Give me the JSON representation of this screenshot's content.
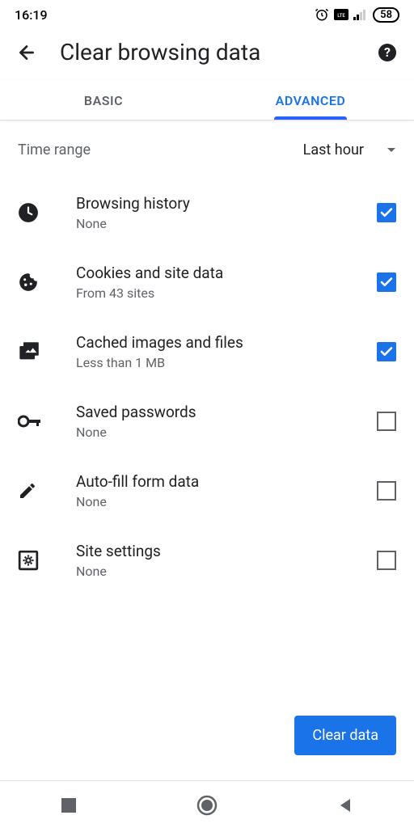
{
  "status": {
    "time": "16:19",
    "battery": "58"
  },
  "header": {
    "title": "Clear browsing data"
  },
  "tabs": {
    "basic": "BASIC",
    "advanced": "ADVANCED"
  },
  "timeRange": {
    "label": "Time range",
    "value": "Last hour"
  },
  "items": [
    {
      "title": "Browsing history",
      "subtitle": "None",
      "checked": true,
      "icon": "clock"
    },
    {
      "title": "Cookies and site data",
      "subtitle": "From 43 sites",
      "checked": true,
      "icon": "cookie"
    },
    {
      "title": "Cached images and files",
      "subtitle": "Less than 1 MB",
      "checked": true,
      "icon": "images"
    },
    {
      "title": "Saved passwords",
      "subtitle": "None",
      "checked": false,
      "icon": "key"
    },
    {
      "title": "Auto-fill form data",
      "subtitle": "None",
      "checked": false,
      "icon": "pencil"
    },
    {
      "title": "Site settings",
      "subtitle": "None",
      "checked": false,
      "icon": "gear-box"
    }
  ],
  "clearButton": "Clear data"
}
